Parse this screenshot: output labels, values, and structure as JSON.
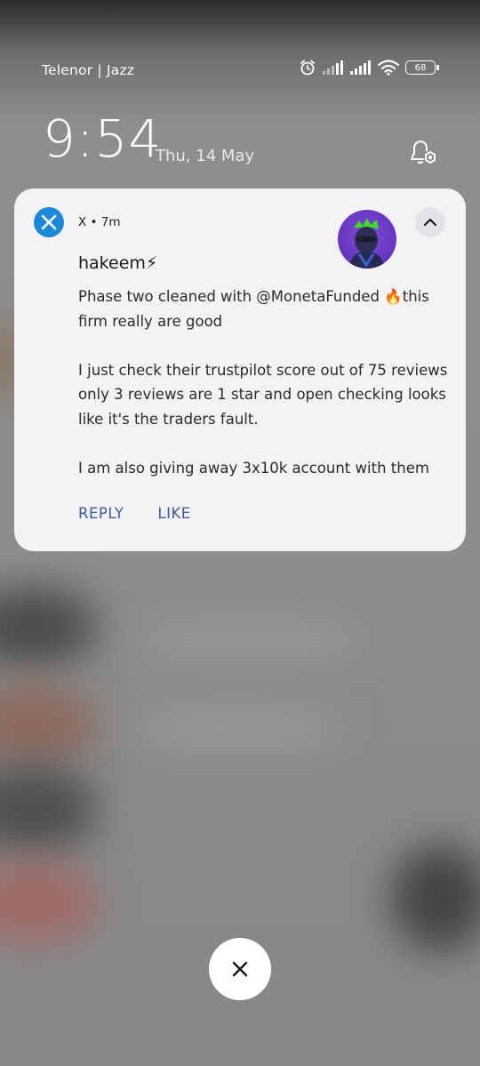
{
  "status_bar": {
    "carrier": "Telenor | Jazz",
    "battery": "68",
    "icons": [
      "alarm-icon",
      "signal-icon",
      "signal-icon",
      "wifi-icon",
      "battery-icon"
    ]
  },
  "lockscreen": {
    "time": "9:54",
    "date": "Thu, 14 May"
  },
  "notification": {
    "app_name": "X",
    "separator": "•",
    "age": "7m",
    "sender": "hakeem⚡",
    "message": "Phase two cleaned with @MonetaFunded 🔥this firm really are good\n\nI just check their trustpilot score  out of 75 reviews only 3 reviews are 1 star and open checking looks like it's the traders fault.\n\nI am also giving away 3x10k account with them",
    "actions": [
      "REPLY",
      "LIKE"
    ]
  },
  "colors": {
    "card_bg": "#f3f3f5",
    "action_text": "#3f5b9a",
    "x_app_icon": "#1d88d8"
  }
}
